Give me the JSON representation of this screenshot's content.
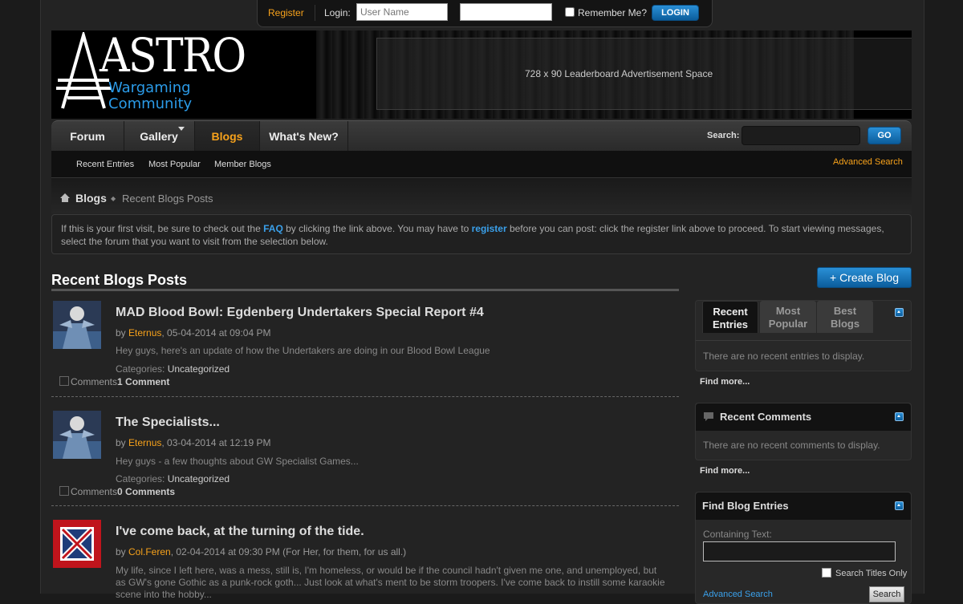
{
  "login_bar": {
    "register": "Register",
    "login_label": "Login:",
    "username_placeholder": "User Name",
    "remember_label": "Remember Me?",
    "login_button": "LOGIN"
  },
  "header": {
    "logo_title": "ASTRO",
    "logo_sub1": "Wargaming",
    "logo_sub2": "Community",
    "ad_text": "728 x 90 Leaderboard Advertisement Space"
  },
  "nav": {
    "tabs": [
      {
        "label": "Forum"
      },
      {
        "label": "Gallery"
      },
      {
        "label": "Blogs"
      },
      {
        "label": "What's New?"
      }
    ],
    "search_label": "Search:",
    "go_button": "GO"
  },
  "subnav": {
    "links": [
      "Recent Entries",
      "Most Popular",
      "Member Blogs"
    ],
    "advanced_search": "Advanced Search"
  },
  "breadcrumb": {
    "root": "Blogs",
    "current": "Recent Blogs Posts"
  },
  "notice": {
    "p1": "If this is your first visit, be sure to check out the ",
    "faq": "FAQ",
    "p2": " by clicking the link above. You may have to ",
    "register": "register",
    "p3": " before you can post: click the register link above to proceed. To start viewing messages, select the forum that you want to visit from the selection below."
  },
  "main": {
    "title": "Recent Blogs Posts",
    "entries": [
      {
        "title": "MAD Blood Bowl: Egdenberg Undertakers Special Report #4",
        "by": "by ",
        "author": "Eternus",
        "date": ", 05-04-2014 at 09:04 PM",
        "excerpt": "Hey guys, here's an update of how the Undertakers are doing in our Blood Bowl League",
        "cat_label": "Categories: ",
        "category": "Uncategorized",
        "comments_alt": "Comments",
        "comments": "1 Comment"
      },
      {
        "title": "The Specialists...",
        "by": "by ",
        "author": "Eternus",
        "date": ", 03-04-2014 at 12:19 PM",
        "excerpt": "Hey guys - a few thoughts about GW Specialist Games...",
        "cat_label": "Categories: ",
        "category": "Uncategorized",
        "comments_alt": "Comments",
        "comments": "0 Comments"
      },
      {
        "title": "I've come back, at the turning of the tide.",
        "by": "by ",
        "author": "Col.Feren",
        "date": ", 02-04-2014 at 09:30 PM (For Her, for them, for us all.)",
        "excerpt": "My life, since I left here, was a mess, still is, I'm homeless, or would be if the council hadn't given me one, and unemployed, but as GW's gone Gothic as a punk-rock goth... Just look at what's ment to be storm troopers. I've come back to instill some karaokie scene into the hobby..."
      }
    ]
  },
  "sidebar": {
    "create_blog": "+ Create Blog",
    "tabs": [
      {
        "line1": "Recent",
        "line2": "Entries"
      },
      {
        "line1": "Most",
        "line2": "Popular"
      },
      {
        "line1": "Best",
        "line2": "Blogs"
      }
    ],
    "no_recent_entries": "There are no recent entries to display.",
    "find_more": "Find more...",
    "recent_comments_title": "Recent Comments",
    "no_recent_comments": "There are no recent comments to display.",
    "find_more2": "Find more...",
    "find_blog_title": "Find Blog Entries",
    "containing_text": "Containing Text:",
    "search_titles_only": "Search Titles Only",
    "advanced_search": "Advanced Search",
    "search_button": "Search"
  }
}
